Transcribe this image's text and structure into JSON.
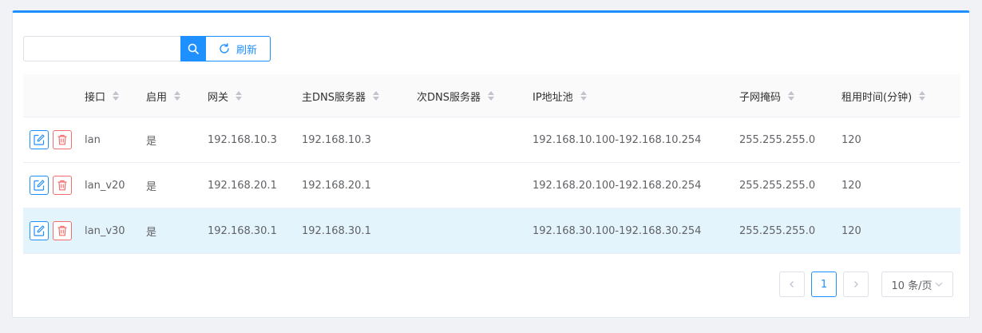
{
  "toolbar": {
    "search_value": "",
    "search_placeholder": "",
    "refresh_label": "刷新"
  },
  "table": {
    "headers": {
      "interface": "接口",
      "enabled": "启用",
      "gateway": "网关",
      "primary_dns": "主DNS服务器",
      "secondary_dns": "次DNS服务器",
      "ip_pool": "IP地址池",
      "subnet_mask": "子网掩码",
      "lease_time": "租用时间(分钟)"
    },
    "rows": [
      {
        "interface": "lan",
        "enabled": "是",
        "gateway": "192.168.10.3",
        "primary_dns": "192.168.10.3",
        "secondary_dns": "",
        "ip_pool": "192.168.10.100-192.168.10.254",
        "subnet_mask": "255.255.255.0",
        "lease_time": "120"
      },
      {
        "interface": "lan_v20",
        "enabled": "是",
        "gateway": "192.168.20.1",
        "primary_dns": "192.168.20.1",
        "secondary_dns": "",
        "ip_pool": "192.168.20.100-192.168.20.254",
        "subnet_mask": "255.255.255.0",
        "lease_time": "120"
      },
      {
        "interface": "lan_v30",
        "enabled": "是",
        "gateway": "192.168.30.1",
        "primary_dns": "192.168.30.1",
        "secondary_dns": "",
        "ip_pool": "192.168.30.100-192.168.30.254",
        "subnet_mask": "255.255.255.0",
        "lease_time": "120"
      }
    ]
  },
  "pagination": {
    "current_page": "1",
    "page_size_label": "10 条/页"
  },
  "icons": {
    "search": "search-icon",
    "refresh": "refresh-icon",
    "edit": "edit-icon",
    "delete": "trash-icon",
    "prev": "chevron-left-icon",
    "next": "chevron-right-icon",
    "dropdown": "chevron-down-icon"
  },
  "colors": {
    "accent": "#1e90ff",
    "danger": "#f56c6c",
    "row_highlight": "#e4f4fc"
  }
}
